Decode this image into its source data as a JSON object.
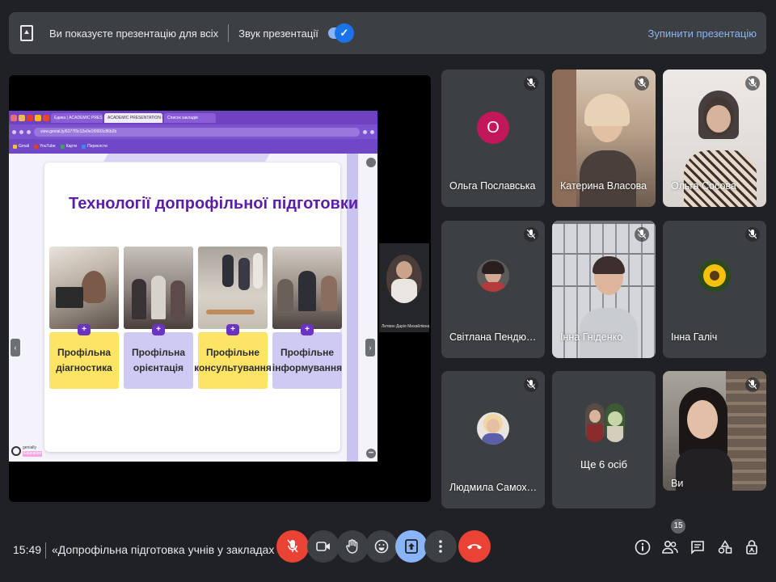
{
  "banner": {
    "message": "Ви показуєте презентацію для всіх",
    "sound_label": "Звук презентації",
    "sound_toggle": "on",
    "stop_label": "Зупинити презентацію"
  },
  "presentation": {
    "browser_tabs": [
      "Едика | ACADEMIC PRESENTATI",
      "ACADEMIC PRESENTATION B",
      "Список закладів"
    ],
    "url": "view.genial.ly/6377f3c12e0e1f0993c86b2b",
    "bookmarks": [
      "Gmail",
      "YouTube",
      "Карти",
      "Переклсти"
    ],
    "slide_title": "Технології допрофільної підготовки",
    "cards": [
      {
        "label": "Профільна діагностика",
        "color": "#fce565"
      },
      {
        "label": "Профільна орієнтація",
        "color": "#cfcaf3"
      },
      {
        "label": "Профільне консультування",
        "color": "#fce565"
      },
      {
        "label": "Профільне інформування",
        "color": "#cfcaf3"
      }
    ],
    "logo_text": "genially",
    "logo_sub": "Education",
    "pip_name": "Литвин Дарія Михайлівна"
  },
  "participants": [
    {
      "name": "Ольга Пославська",
      "avatar_letter": "О",
      "muted": true,
      "kind": "letter"
    },
    {
      "name": "Катерина Власова",
      "muted": true,
      "kind": "video"
    },
    {
      "name": "Ольга Сосова",
      "muted": true,
      "kind": "video"
    },
    {
      "name": "Світлана Пендюх Л...",
      "muted": true,
      "kind": "photo"
    },
    {
      "name": "Інна Гніденко",
      "muted": true,
      "kind": "video"
    },
    {
      "name": "Інна Галіч",
      "muted": true,
      "kind": "photo"
    },
    {
      "name": "Людмила Самохвал...",
      "muted": true,
      "kind": "photo"
    },
    {
      "name": "Ще 6 осіб",
      "kind": "more"
    },
    {
      "name": "Ви",
      "muted": true,
      "kind": "video"
    }
  ],
  "bottom": {
    "time": "15:49",
    "meeting_title": "«Допрофільна підготовка учнів у закладах ...",
    "people_count": "15"
  },
  "colors": {
    "background": "#202124",
    "surface": "#3c4043",
    "accent": "#8ab4f8",
    "danger": "#ea4335",
    "slide_title": "#5a1ea8"
  }
}
